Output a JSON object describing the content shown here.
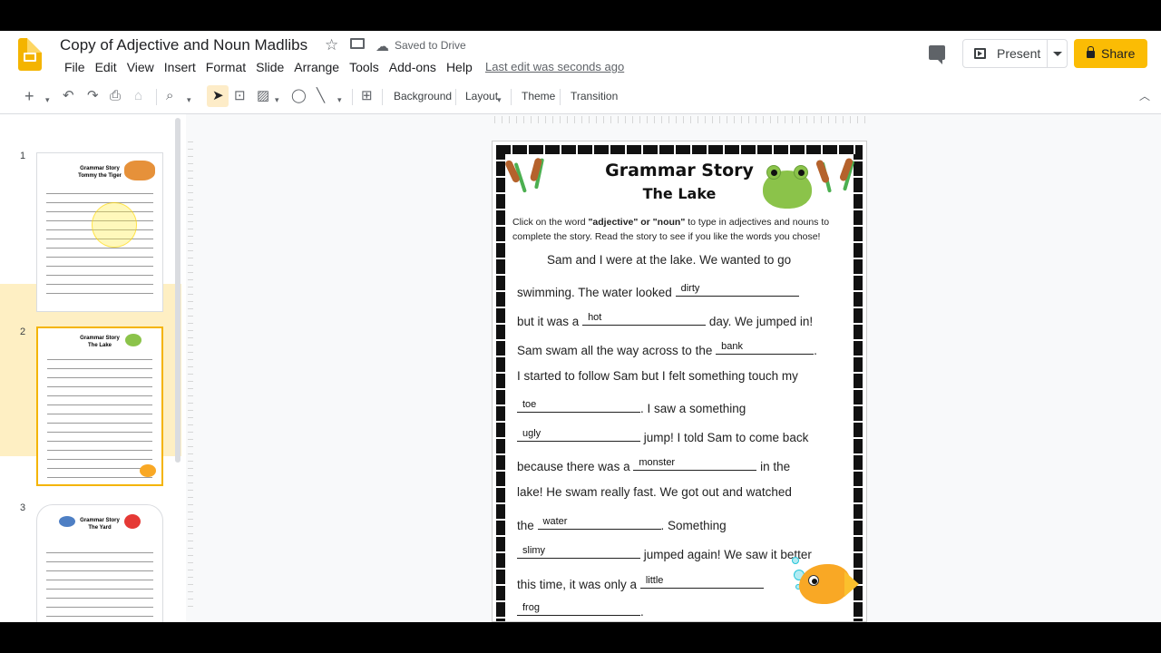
{
  "doc": {
    "title": "Copy of Adjective and Noun Madlibs",
    "saved_status": "Saved to Drive",
    "last_edit": "Last edit was seconds ago"
  },
  "menu": [
    "File",
    "Edit",
    "View",
    "Insert",
    "Format",
    "Slide",
    "Arrange",
    "Tools",
    "Add-ons",
    "Help"
  ],
  "header_buttons": {
    "present": "Present",
    "share": "Share"
  },
  "toolbar": {
    "background": "Background",
    "layout": "Layout",
    "theme": "Theme",
    "transition": "Transition"
  },
  "filmstrip": {
    "slides": [
      {
        "number": "1",
        "title": "Grammar Story",
        "subtitle": "Tommy the Tiger"
      },
      {
        "number": "2",
        "title": "Grammar Story",
        "subtitle": "The Lake"
      },
      {
        "number": "3",
        "title": "Grammar Story",
        "subtitle": "The Yard"
      }
    ]
  },
  "slide": {
    "title": "Grammar Story",
    "subtitle": "The Lake",
    "instruction_pre": "Click on the word ",
    "instruction_bold": "\"adjective\" or \"noun\"",
    "instruction_post": " to type in adjectives and nouns to complete the story. Read the story to see if you like the words you chose!",
    "lines": [
      {
        "pre": "Sam and I were at the lake. We wanted to go",
        "word": "",
        "post": ""
      },
      {
        "pre": "swimming. The water looked",
        "word": "dirty",
        "post": ""
      },
      {
        "pre": "but it was a",
        "word": "hot",
        "post": " day. We jumped in!"
      },
      {
        "pre": "Sam swam all the way across to the",
        "word": "bank",
        "post": "."
      },
      {
        "pre": "I started to follow Sam but I felt something touch my",
        "word": "",
        "post": ""
      },
      {
        "pre": "",
        "word": "toe",
        "post": ". I saw a  something"
      },
      {
        "pre": "",
        "word": "ugly",
        "post": " jump! I told Sam to come back"
      },
      {
        "pre": "because there was a",
        "word": "monster",
        "post": " in  the"
      },
      {
        "pre": "lake! He swam really fast. We got out and watched",
        "word": "",
        "post": ""
      },
      {
        "pre": "the",
        "word": "water",
        "post": ". Something"
      },
      {
        "pre": "",
        "word": "slimy",
        "post": " jumped again! We saw it better"
      },
      {
        "pre": "this time, it was only a",
        "word": "little",
        "post": ""
      },
      {
        "pre": "",
        "word": "frog",
        "post": "."
      }
    ]
  }
}
